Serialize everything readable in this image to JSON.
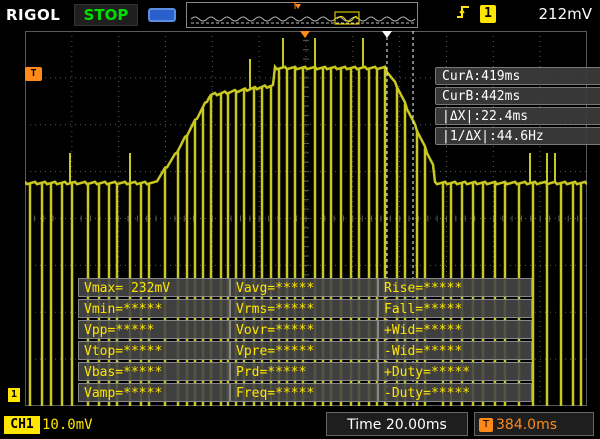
{
  "header": {
    "brand": "RIGOL",
    "run_state": "STOP",
    "trigger_channel": "1",
    "trigger_level": "212mV",
    "trigger_marker_top": "T"
  },
  "cursors": {
    "cur_a": "CurA:419ms",
    "cur_b": "CurB:442ms",
    "delta_x": "|ΔX|:22.4ms",
    "inv_delta_x": "|1/ΔX|:44.6Hz"
  },
  "measurements": {
    "col1": [
      "Vmax= 232mV",
      "Vmin=*****",
      "Vpp=*****",
      "Vtop=*****",
      "Vbas=*****",
      "Vamp=*****"
    ],
    "col2": [
      "Vavg=*****",
      "Vrms=*****",
      "Vovr=*****",
      "Vpre=*****",
      "Prd=*****",
      "Freq=*****"
    ],
    "col3": [
      "Rise=*****",
      "Fall=*****",
      "+Wid=*****",
      "-Wid=*****",
      "+Duty=*****",
      "-Duty=*****"
    ]
  },
  "footer": {
    "channel_label": "CH1",
    "channel_scale": "10.0mV",
    "timebase": "Time 20.00ms",
    "trigger_offset": "384.0ms",
    "offset_icon_letter": "T"
  },
  "markers": {
    "trigger_flag": "T",
    "ground_flag": "1"
  },
  "colors": {
    "trace": "#c8c81e",
    "grid": "#5a5a5a",
    "trigger_orange": "#ff8a1a",
    "channel_yellow": "#ffe600",
    "run_green": "#00e000"
  }
}
